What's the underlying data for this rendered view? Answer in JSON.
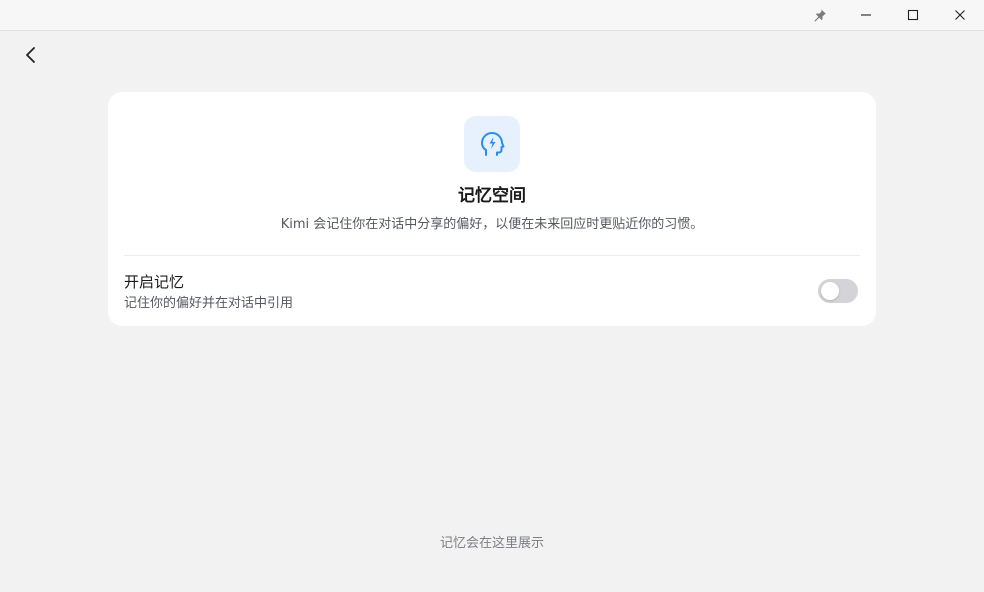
{
  "window": {
    "pin_icon": "pin-icon",
    "minimize_icon": "minimize-icon",
    "maximize_icon": "maximize-icon",
    "close_icon": "close-icon"
  },
  "nav": {
    "back_icon": "chevron-left-icon"
  },
  "card": {
    "icon": "head-bolt-icon",
    "accent": "#2b8cee",
    "icon_bg": "#e6f1fd",
    "title": "记忆空间",
    "description": "Kimi 会记住你在对话中分享的偏好，以便在未来回应时更贴近你的习惯。",
    "setting": {
      "label": "开启记忆",
      "sublabel": "记住你的偏好并在对话中引用",
      "enabled": false
    }
  },
  "empty_state": {
    "text": "记忆会在这里展示"
  }
}
